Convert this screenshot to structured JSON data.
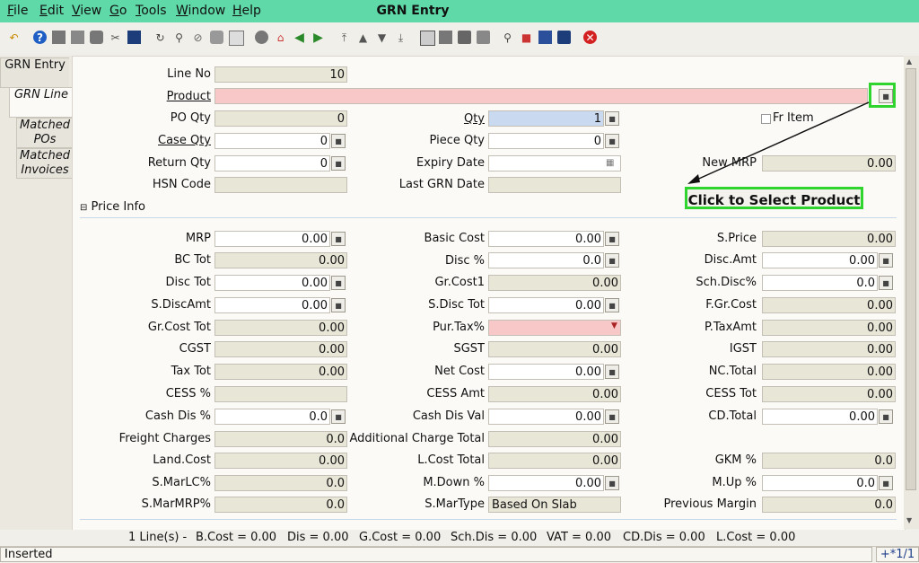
{
  "window": {
    "title": "GRN Entry"
  },
  "menu": [
    {
      "label": "File",
      "key": "F",
      "rest": "ile"
    },
    {
      "label": "Edit",
      "key": "E",
      "rest": "dit"
    },
    {
      "label": "View",
      "key": "V",
      "rest": "iew"
    },
    {
      "label": "Go",
      "key": "G",
      "rest": "o"
    },
    {
      "label": "Tools",
      "key": "T",
      "rest": "ools"
    },
    {
      "label": "Window",
      "key": "W",
      "rest": "indow"
    },
    {
      "label": "Help",
      "key": "H",
      "rest": "elp"
    }
  ],
  "toolbar": {
    "icons": [
      "undo-icon",
      "help-icon",
      "new-icon",
      "copy-icon",
      "delete-icon",
      "cut-icon",
      "save-icon",
      "refresh-icon",
      "find-icon",
      "attach-icon",
      "chat-icon",
      "history-icon",
      "home-icon",
      "menu-icon",
      "back-icon",
      "forward-icon",
      "first-icon",
      "previous-icon",
      "next-icon",
      "last-icon",
      "report-icon",
      "archive-icon",
      "print-icon",
      "print-preview-icon",
      "zoom-icon",
      "workflow-icon",
      "request-icon",
      "product-info-icon",
      "close-icon"
    ]
  },
  "tabs": [
    {
      "label": "GRN Entry",
      "active": false
    },
    {
      "label": "GRN Line",
      "active": true
    },
    {
      "label": "Matched POs",
      "active": false
    },
    {
      "label": "Matched Invoices",
      "active": false
    }
  ],
  "form": {
    "line_no": {
      "label": "Line No",
      "value": "10"
    },
    "product": {
      "label": "Product",
      "value": ""
    },
    "po_qty": {
      "label": "PO Qty",
      "value": "0"
    },
    "qty": {
      "label": "Qty",
      "value": "1"
    },
    "fr_item": {
      "label": "Fr Item",
      "checked": false
    },
    "case_qty": {
      "label": "Case Qty",
      "value": "0"
    },
    "piece_qty": {
      "label": "Piece Qty",
      "value": "0"
    },
    "return_qty": {
      "label": "Return Qty",
      "value": "0"
    },
    "expiry_date": {
      "label": "Expiry Date",
      "value": ""
    },
    "new_mrp": {
      "label": "New MRP",
      "value": "0.00"
    },
    "hsn_code": {
      "label": "HSN Code",
      "value": ""
    },
    "last_grn_date": {
      "label": "Last GRN Date",
      "value": ""
    }
  },
  "price_section": {
    "label": "Price Info"
  },
  "price": {
    "mrp": {
      "label": "MRP",
      "value": "0.00"
    },
    "basic_cost": {
      "label": "Basic Cost",
      "value": "0.00"
    },
    "s_price": {
      "label": "S.Price",
      "value": "0.00"
    },
    "bc_tot": {
      "label": "BC Tot",
      "value": "0.00"
    },
    "disc_pct": {
      "label": "Disc %",
      "value": "0.0"
    },
    "disc_amt": {
      "label": "Disc.Amt",
      "value": "0.00"
    },
    "disc_tot": {
      "label": "Disc Tot",
      "value": "0.00"
    },
    "gr_cost1": {
      "label": "Gr.Cost1",
      "value": "0.00"
    },
    "sch_disc": {
      "label": "Sch.Disc%",
      "value": "0.0"
    },
    "s_discamt": {
      "label": "S.DiscAmt",
      "value": "0.00"
    },
    "s_disc_tot": {
      "label": "S.Disc Tot",
      "value": "0.00"
    },
    "f_gr_cost": {
      "label": "F.Gr.Cost",
      "value": "0.00"
    },
    "gr_cost_tot": {
      "label": "Gr.Cost Tot",
      "value": "0.00"
    },
    "pur_tax": {
      "label": "Pur.Tax%",
      "value": ""
    },
    "p_taxamt": {
      "label": "P.TaxAmt",
      "value": "0.00"
    },
    "cgst": {
      "label": "CGST",
      "value": "0.00"
    },
    "sgst": {
      "label": "SGST",
      "value": "0.00"
    },
    "igst": {
      "label": "IGST",
      "value": "0.00"
    },
    "tax_tot": {
      "label": "Tax Tot",
      "value": "0.00"
    },
    "net_cost": {
      "label": "Net Cost",
      "value": "0.00"
    },
    "nc_total": {
      "label": "NC.Total",
      "value": "0.00"
    },
    "cess_pct": {
      "label": "CESS %",
      "value": ""
    },
    "cess_amt": {
      "label": "CESS Amt",
      "value": "0.00"
    },
    "cess_tot": {
      "label": "CESS Tot",
      "value": "0.00"
    },
    "cash_dis_pct": {
      "label": "Cash Dis %",
      "value": "0.0"
    },
    "cash_dis_val": {
      "label": "Cash Dis Val",
      "value": "0.00"
    },
    "cd_total": {
      "label": "CD.Total",
      "value": "0.00"
    },
    "freight": {
      "label": "Freight Charges",
      "value": "0.0"
    },
    "additional_charge": {
      "label": "Additional Charge Total",
      "value": "0.00"
    },
    "land_cost": {
      "label": "Land.Cost",
      "value": "0.00"
    },
    "l_cost_total": {
      "label": "L.Cost Total",
      "value": "0.00"
    },
    "gkm_pct": {
      "label": "GKM %",
      "value": "0.0"
    },
    "s_marlc": {
      "label": "S.MarLC%",
      "value": "0.0"
    },
    "m_down": {
      "label": "M.Down %",
      "value": "0.00"
    },
    "m_up": {
      "label": "M.Up %",
      "value": "0.0"
    },
    "s_marmrp": {
      "label": "S.MarMRP%",
      "value": "0.0"
    },
    "s_martype": {
      "label": "S.MarType",
      "value": "Based On Slab"
    },
    "previous_margin": {
      "label": "Previous Margin",
      "value": "0.0"
    }
  },
  "annotation": {
    "text": "Click to Select Product"
  },
  "summary": {
    "lines": "1 Line(s) -",
    "b_cost": "B.Cost = 0.00",
    "dis": "Dis = 0.00",
    "g_cost": "G.Cost = 0.00",
    "sch_dis": "Sch.Dis = 0.00",
    "vat": "VAT = 0.00",
    "cd_dis": "CD.Dis = 0.00",
    "l_cost": "L.Cost = 0.00"
  },
  "statusbar": {
    "text": "Inserted",
    "record": "+*1/1"
  },
  "colors": {
    "menubar": "#5fd9a8",
    "highlight": "#2fd42f",
    "required": "#f8c8c8",
    "selected": "#c9daf0"
  }
}
